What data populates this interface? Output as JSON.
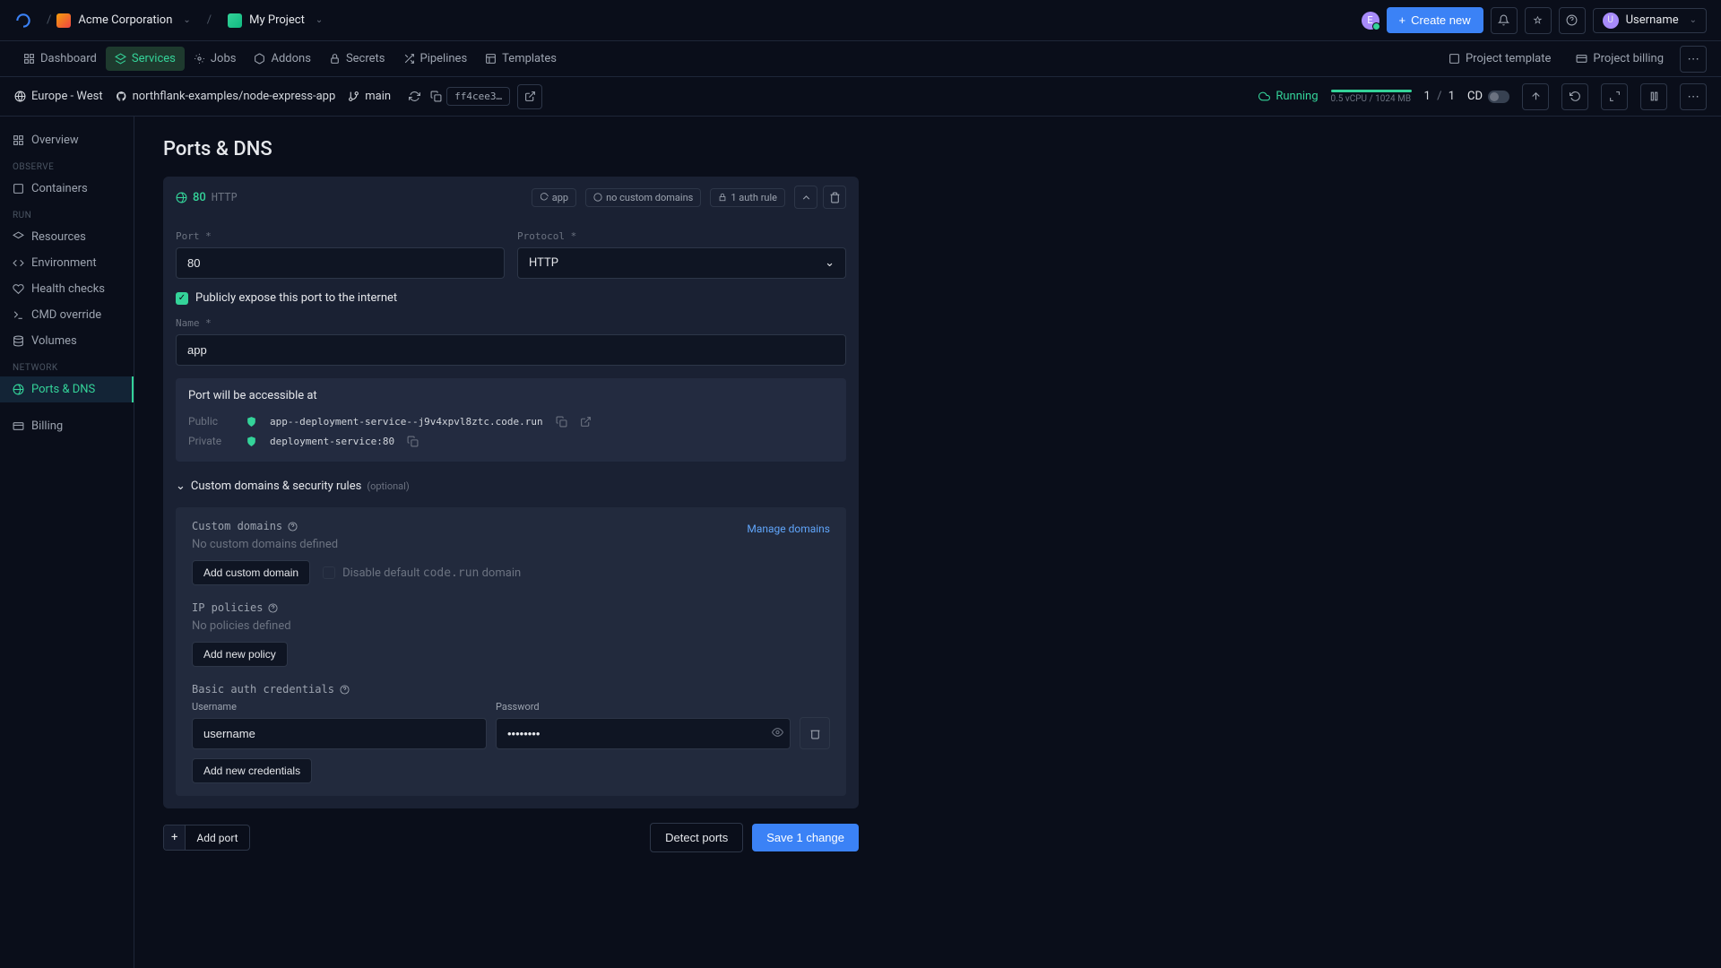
{
  "topbar": {
    "org": "Acme Corporation",
    "project": "My Project",
    "create_label": "Create new",
    "username": "Username",
    "user_initial": "U",
    "avatar_initial": "E"
  },
  "secnav": {
    "tabs": [
      {
        "label": "Dashboard",
        "icon": "grid"
      },
      {
        "label": "Services",
        "icon": "layers",
        "active": true
      },
      {
        "label": "Jobs",
        "icon": "run"
      },
      {
        "label": "Addons",
        "icon": "cube"
      },
      {
        "label": "Secrets",
        "icon": "lock"
      },
      {
        "label": "Pipelines",
        "icon": "shuffle"
      },
      {
        "label": "Templates",
        "icon": "template"
      }
    ],
    "right": [
      {
        "label": "Project template"
      },
      {
        "label": "Project billing"
      }
    ]
  },
  "ctx": {
    "region": "Europe - West",
    "repo": "northflank-examples/node-express-app",
    "branch": "main",
    "hash": "ff4cee3…",
    "status": "Running",
    "resources": "0.5 vCPU / 1024 MB",
    "replicas_current": "1",
    "replicas_sep": "/",
    "replicas_total": "1",
    "cd_label": "CD"
  },
  "sidebar": {
    "items": [
      {
        "label": "Overview",
        "icon": "grid"
      }
    ],
    "groups": [
      {
        "title": "OBSERVE",
        "items": [
          {
            "label": "Containers",
            "icon": "box"
          }
        ]
      },
      {
        "title": "RUN",
        "items": [
          {
            "label": "Resources",
            "icon": "layers"
          },
          {
            "label": "Environment",
            "icon": "code"
          },
          {
            "label": "Health checks",
            "icon": "heart"
          },
          {
            "label": "CMD override",
            "icon": "terminal"
          },
          {
            "label": "Volumes",
            "icon": "db"
          }
        ]
      },
      {
        "title": "NETWORK",
        "items": [
          {
            "label": "Ports & DNS",
            "icon": "globe",
            "active": true
          }
        ]
      }
    ],
    "billing": "Billing"
  },
  "page": {
    "title": "Ports & DNS"
  },
  "port": {
    "number": "80",
    "protocol": "HTTP",
    "chips": {
      "app_name": "app",
      "domains": "no custom domains",
      "auth": "1 auth rule"
    },
    "form": {
      "port_label": "Port *",
      "port_value": "80",
      "protocol_label": "Protocol *",
      "protocol_value": "HTTP",
      "expose_label": "Publicly expose this port to the internet",
      "name_label": "Name *",
      "name_value": "app"
    },
    "access": {
      "title": "Port will be accessible at",
      "public_label": "Public",
      "public_url": "app--deployment-service--j9v4xpvl8ztc.code.run",
      "private_label": "Private",
      "private_url": "deployment-service:80"
    },
    "security": {
      "header": "Custom domains & security rules",
      "optional": "(optional)",
      "custom_domains_title": "Custom domains",
      "manage_domains": "Manage domains",
      "no_domains": "No custom domains defined",
      "add_domain_btn": "Add custom domain",
      "disable_default": "Disable default code.run domain",
      "ip_title": "IP policies",
      "no_policies": "No policies defined",
      "add_policy_btn": "Add new policy",
      "basic_auth_title": "Basic auth credentials",
      "username_label": "Username",
      "username_value": "username",
      "password_label": "Password",
      "password_value": "••••••••",
      "add_creds_btn": "Add new credentials"
    }
  },
  "footer": {
    "add_port": "Add port",
    "detect": "Detect ports",
    "save": "Save 1 change"
  }
}
